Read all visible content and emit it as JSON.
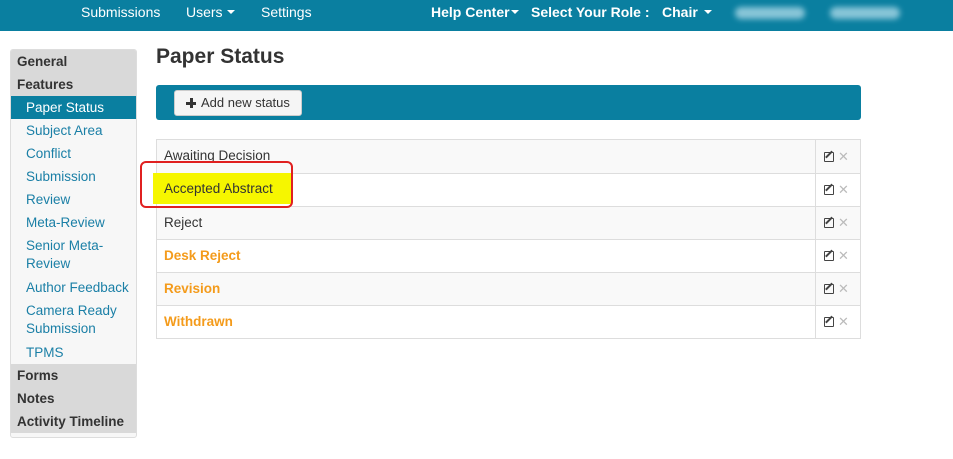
{
  "topnav": {
    "submissions": "Submissions",
    "users": "Users",
    "settings": "Settings",
    "help_center": "Help Center",
    "role_label": "Select Your Role :",
    "role_value": "Chair"
  },
  "sidebar": {
    "general": "General",
    "features": "Features",
    "items": [
      "Paper Status",
      "Subject Area",
      "Conflict",
      "Submission",
      "Review",
      "Meta-Review",
      "Senior Meta-Review",
      "Author Feedback",
      "Camera Ready Submission",
      "TPMS"
    ],
    "forms": "Forms",
    "notes": "Notes",
    "activity_timeline": "Activity Timeline"
  },
  "main": {
    "title": "Paper Status",
    "add_button": "Add new status",
    "statuses": [
      {
        "name": "Awaiting Decision",
        "color": "default"
      },
      {
        "name": "Accepted Abstract",
        "color": "highlighted"
      },
      {
        "name": "Reject",
        "color": "default"
      },
      {
        "name": "Desk Reject",
        "color": "#f49b1b"
      },
      {
        "name": "Revision",
        "color": "#f49b1b"
      },
      {
        "name": "Withdrawn",
        "color": "#f49b1b"
      }
    ]
  },
  "colors": {
    "brand": "#0a7fa0",
    "orange": "#f49b1b",
    "highlight": "#f6f600",
    "annotation": "#e02020"
  }
}
